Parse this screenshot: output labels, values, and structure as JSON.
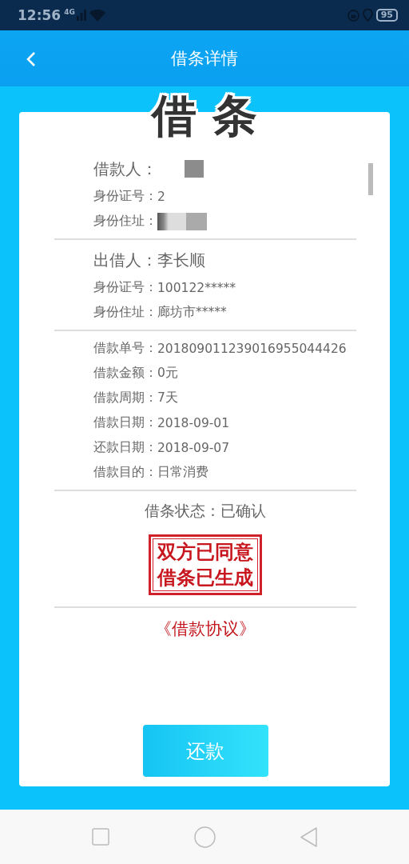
{
  "status_bar": {
    "time": "12:56",
    "network": "4G",
    "battery": "95"
  },
  "header": {
    "title": "借条详情"
  },
  "document_title": "借 条",
  "borrower": {
    "label": "借款人：",
    "redacted": true,
    "fields": [
      {
        "label": "身份证号：",
        "value": "2"
      },
      {
        "label": "身份住址：",
        "redacted": true
      }
    ]
  },
  "lender": {
    "label": "出借人：",
    "value": "李长顺",
    "fields": [
      {
        "label": "身份证号：",
        "value": "100122*****"
      },
      {
        "label": "身份住址：",
        "value": "廊坊市*****"
      }
    ]
  },
  "loan_details": [
    {
      "label": "借款单号：",
      "value": "201809011239016955044426"
    },
    {
      "label": "借款金额：",
      "value": "0元"
    },
    {
      "label": "借款周期：",
      "value": "7天"
    },
    {
      "label": "借款日期：",
      "value": "2018-09-01"
    },
    {
      "label": "还款日期：",
      "value": "2018-09-07"
    },
    {
      "label": "借款目的：",
      "value": "日常消费"
    }
  ],
  "status": {
    "label": "借条状态：",
    "value": "已确认"
  },
  "stamp": [
    "双方已同意",
    "借条已生成"
  ],
  "agreement_link": "《借款协议》",
  "repay_button": "还款"
}
